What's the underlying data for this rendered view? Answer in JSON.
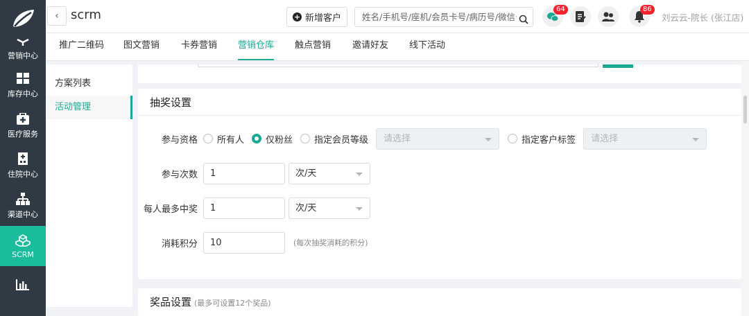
{
  "nav": {
    "items": [
      {
        "label": "营销中心",
        "icon": "megaphone-icon"
      },
      {
        "label": "库存中心",
        "icon": "grid-icon"
      },
      {
        "label": "医疗服务",
        "icon": "medical-kit-icon"
      },
      {
        "label": "住院中心",
        "icon": "hospital-icon"
      },
      {
        "label": "渠道中心",
        "icon": "org-chart-icon"
      },
      {
        "label": "SCRM",
        "icon": "cubes-icon"
      },
      {
        "label": "",
        "icon": "bar-chart-icon"
      }
    ],
    "active_color": "#1abc9c"
  },
  "header": {
    "back": "‹",
    "title": "scrm",
    "add_customer": "新增客户",
    "search_placeholder": "姓名/手机号/座机/会员卡号/病历号/微信号",
    "wechat_badge": "64",
    "bell_badge": "86",
    "user": "刘云云-院长 (张江店)"
  },
  "tabs": [
    "推广二维码",
    "图文营销",
    "卡券营销",
    "营销仓库",
    "触点营销",
    "邀请好友",
    "线下活动"
  ],
  "active_tab": "营销仓库",
  "side": {
    "items": [
      "方案列表",
      "活动管理"
    ],
    "active": "活动管理"
  },
  "lottery": {
    "title": "抽奖设置",
    "eligibility_label": "参与资格",
    "options": {
      "all": "所有人",
      "fans": "仅粉丝",
      "member_level": "指定会员等级",
      "customer_tag": "指定客户标签"
    },
    "selected": "仅粉丝",
    "select_placeholder": "请选择",
    "times_label": "参与次数",
    "times_value": "1",
    "times_unit": "次/天",
    "max_win_label": "每人最多中奖",
    "max_win_value": "1",
    "max_win_unit": "次/天",
    "points_label": "消耗积分",
    "points_value": "10",
    "points_hint": "(每次抽奖消耗的积分)"
  },
  "prize": {
    "title": "奖品设置",
    "note": "(最多可设置12个奖品)"
  },
  "colors": {
    "accent": "#1aa994",
    "badge": "#f5222d"
  }
}
